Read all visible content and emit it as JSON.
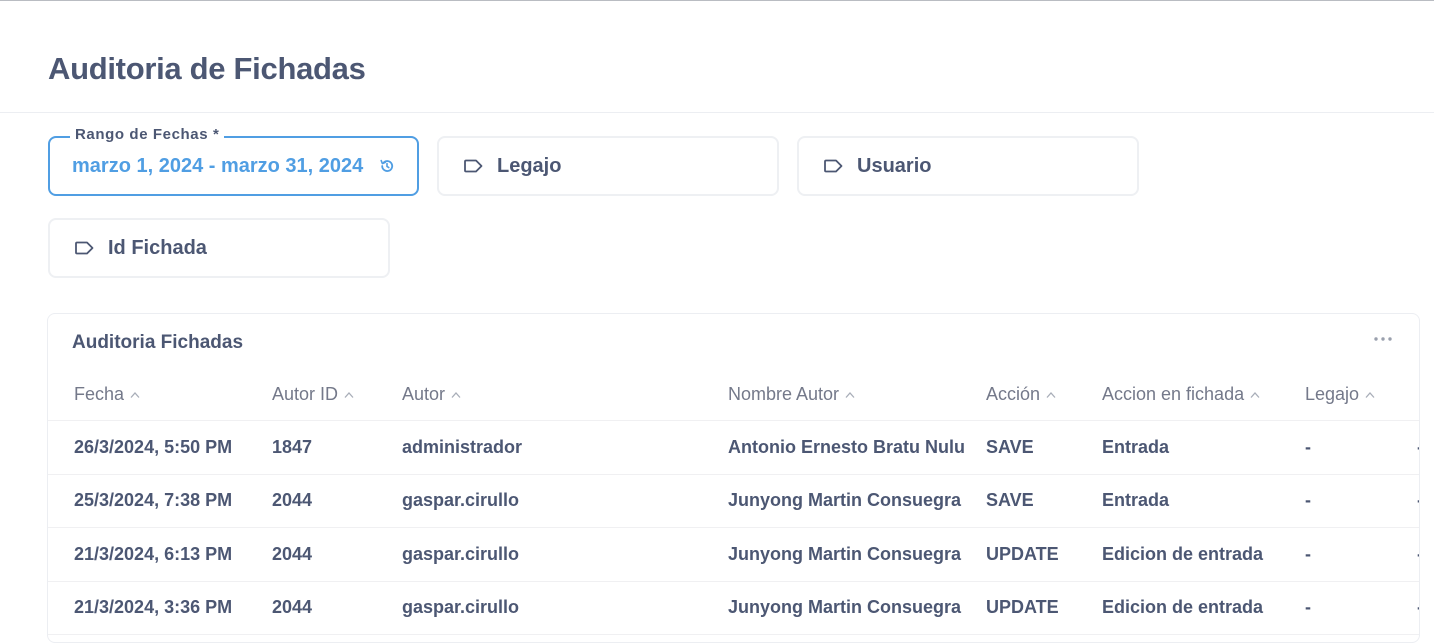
{
  "page": {
    "title": "Auditoria de Fichadas"
  },
  "filters": {
    "date_range": {
      "label": "Rango de Fechas *",
      "value": "marzo 1, 2024 - marzo 31, 2024"
    },
    "legajo": {
      "placeholder": "Legajo"
    },
    "usuario": {
      "placeholder": "Usuario"
    },
    "id_fichada": {
      "placeholder": "Id Fichada"
    }
  },
  "card": {
    "title": "Auditoria Fichadas",
    "columns": [
      "Fecha",
      "Autor ID",
      "Autor",
      "Nombre Autor",
      "Acción",
      "Accion en fichada",
      "Legajo"
    ],
    "rows": [
      [
        "26/3/2024, 5:50 PM",
        "1847",
        "administrador",
        "Antonio Ernesto Bratu Nulu",
        "SAVE",
        "Entrada",
        "-",
        "-"
      ],
      [
        "25/3/2024, 7:38 PM",
        "2044",
        "gaspar.cirullo",
        "Junyong Martin Consuegra",
        "SAVE",
        "Entrada",
        "-",
        "-"
      ],
      [
        "21/3/2024, 6:13 PM",
        "2044",
        "gaspar.cirullo",
        "Junyong Martin Consuegra",
        "UPDATE",
        "Edicion de entrada",
        "-",
        "-"
      ],
      [
        "21/3/2024, 3:36 PM",
        "2044",
        "gaspar.cirullo",
        "Junyong Martin Consuegra",
        "UPDATE",
        "Edicion de entrada",
        "-",
        "-"
      ]
    ]
  },
  "colors": {
    "accent": "#509ee3",
    "text": "#4c5773",
    "muted": "#74798a",
    "border": "#eceef2"
  },
  "icons": {
    "tag": "tag-icon",
    "history": "history-icon",
    "more": "more-icon",
    "sort": "sort-ascending-icon"
  }
}
